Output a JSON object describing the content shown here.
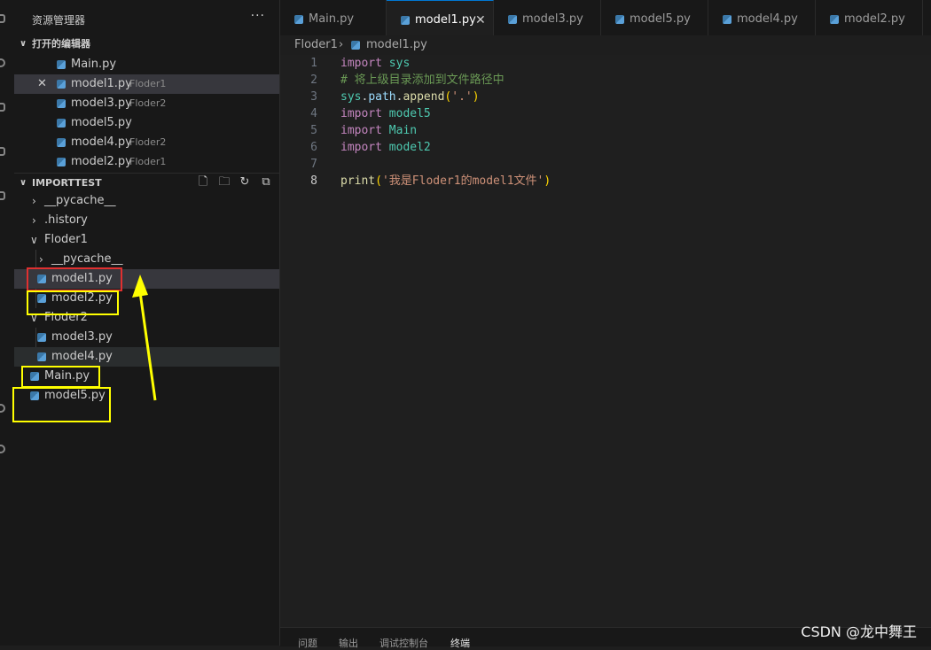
{
  "explorer": {
    "title": "资源管理器",
    "more": "···",
    "open_editors": {
      "header": "打开的编辑器",
      "items": [
        {
          "name": "Main.py",
          "desc": ""
        },
        {
          "name": "model1.py",
          "desc": "Floder1"
        },
        {
          "name": "model3.py",
          "desc": "Floder2"
        },
        {
          "name": "model5.py",
          "desc": ""
        },
        {
          "name": "model4.py",
          "desc": "Floder2"
        },
        {
          "name": "model2.py",
          "desc": "Floder1"
        }
      ]
    },
    "workspace": {
      "header": "IMPORTTEST",
      "tree": [
        {
          "name": "__pycache__",
          "type": "folder"
        },
        {
          "name": ".history",
          "type": "folder"
        },
        {
          "name": "Floder1",
          "type": "folder-open"
        },
        {
          "name": "__pycache__",
          "type": "folder"
        },
        {
          "name": "model1.py",
          "type": "file"
        },
        {
          "name": "model2.py",
          "type": "file"
        },
        {
          "name": "Floder2",
          "type": "folder-open"
        },
        {
          "name": "model3.py",
          "type": "file"
        },
        {
          "name": "model4.py",
          "type": "file"
        },
        {
          "name": "Main.py",
          "type": "file"
        },
        {
          "name": "model5.py",
          "type": "file"
        }
      ]
    }
  },
  "tabs": [
    {
      "label": "Main.py"
    },
    {
      "label": "model1.py",
      "close": "✕"
    },
    {
      "label": "model3.py"
    },
    {
      "label": "model5.py"
    },
    {
      "label": "model4.py"
    },
    {
      "label": "model2.py"
    }
  ],
  "breadcrumb": {
    "folder": "Floder1",
    "sep": "›",
    "file": "model1.py"
  },
  "editor": {
    "line_numbers": [
      "1",
      "2",
      "3",
      "4",
      "5",
      "6",
      "7",
      "8"
    ],
    "lines": [
      [
        {
          "t": "import",
          "c": "kw"
        },
        {
          "t": " ",
          "c": ""
        },
        {
          "t": "sys",
          "c": "mod"
        }
      ],
      [
        {
          "t": "# 将上级目录添加到文件路径中",
          "c": "cm"
        }
      ],
      [
        {
          "t": "sys",
          "c": "mod"
        },
        {
          "t": ".",
          "c": ""
        },
        {
          "t": "path",
          "c": "var"
        },
        {
          "t": ".",
          "c": ""
        },
        {
          "t": "append",
          "c": "fn"
        },
        {
          "t": "(",
          "c": "br"
        },
        {
          "t": "'.'",
          "c": "str"
        },
        {
          "t": ")",
          "c": "br"
        }
      ],
      [
        {
          "t": "import",
          "c": "kw"
        },
        {
          "t": " ",
          "c": ""
        },
        {
          "t": "model5",
          "c": "mod"
        }
      ],
      [
        {
          "t": "import",
          "c": "kw"
        },
        {
          "t": " ",
          "c": ""
        },
        {
          "t": "Main",
          "c": "mod"
        }
      ],
      [
        {
          "t": "import",
          "c": "kw"
        },
        {
          "t": " ",
          "c": ""
        },
        {
          "t": "model2",
          "c": "mod"
        }
      ],
      [],
      [
        {
          "t": "print",
          "c": "fn"
        },
        {
          "t": "(",
          "c": "br"
        },
        {
          "t": "'我是Floder1的model1文件'",
          "c": "str"
        },
        {
          "t": ")",
          "c": "br"
        }
      ]
    ]
  },
  "panel_tabs": [
    "问题",
    "输出",
    "调试控制台",
    "终端"
  ],
  "watermark": "CSDN @龙中舞王",
  "colors": {
    "annotation_red": "#e03030",
    "annotation_yellow": "#ffff00",
    "accent": "#0078d4"
  }
}
